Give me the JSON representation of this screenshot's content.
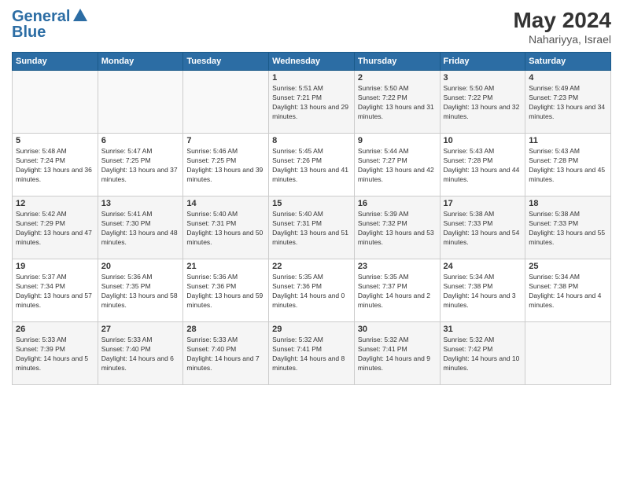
{
  "header": {
    "logo_line1": "General",
    "logo_line2": "Blue",
    "month_year": "May 2024",
    "location": "Nahariyya, Israel"
  },
  "weekdays": [
    "Sunday",
    "Monday",
    "Tuesday",
    "Wednesday",
    "Thursday",
    "Friday",
    "Saturday"
  ],
  "weeks": [
    [
      {
        "day": "",
        "sunrise": "",
        "sunset": "",
        "daylight": ""
      },
      {
        "day": "",
        "sunrise": "",
        "sunset": "",
        "daylight": ""
      },
      {
        "day": "",
        "sunrise": "",
        "sunset": "",
        "daylight": ""
      },
      {
        "day": "1",
        "sunrise": "Sunrise: 5:51 AM",
        "sunset": "Sunset: 7:21 PM",
        "daylight": "Daylight: 13 hours and 29 minutes."
      },
      {
        "day": "2",
        "sunrise": "Sunrise: 5:50 AM",
        "sunset": "Sunset: 7:22 PM",
        "daylight": "Daylight: 13 hours and 31 minutes."
      },
      {
        "day": "3",
        "sunrise": "Sunrise: 5:50 AM",
        "sunset": "Sunset: 7:22 PM",
        "daylight": "Daylight: 13 hours and 32 minutes."
      },
      {
        "day": "4",
        "sunrise": "Sunrise: 5:49 AM",
        "sunset": "Sunset: 7:23 PM",
        "daylight": "Daylight: 13 hours and 34 minutes."
      }
    ],
    [
      {
        "day": "5",
        "sunrise": "Sunrise: 5:48 AM",
        "sunset": "Sunset: 7:24 PM",
        "daylight": "Daylight: 13 hours and 36 minutes."
      },
      {
        "day": "6",
        "sunrise": "Sunrise: 5:47 AM",
        "sunset": "Sunset: 7:25 PM",
        "daylight": "Daylight: 13 hours and 37 minutes."
      },
      {
        "day": "7",
        "sunrise": "Sunrise: 5:46 AM",
        "sunset": "Sunset: 7:25 PM",
        "daylight": "Daylight: 13 hours and 39 minutes."
      },
      {
        "day": "8",
        "sunrise": "Sunrise: 5:45 AM",
        "sunset": "Sunset: 7:26 PM",
        "daylight": "Daylight: 13 hours and 41 minutes."
      },
      {
        "day": "9",
        "sunrise": "Sunrise: 5:44 AM",
        "sunset": "Sunset: 7:27 PM",
        "daylight": "Daylight: 13 hours and 42 minutes."
      },
      {
        "day": "10",
        "sunrise": "Sunrise: 5:43 AM",
        "sunset": "Sunset: 7:28 PM",
        "daylight": "Daylight: 13 hours and 44 minutes."
      },
      {
        "day": "11",
        "sunrise": "Sunrise: 5:43 AM",
        "sunset": "Sunset: 7:28 PM",
        "daylight": "Daylight: 13 hours and 45 minutes."
      }
    ],
    [
      {
        "day": "12",
        "sunrise": "Sunrise: 5:42 AM",
        "sunset": "Sunset: 7:29 PM",
        "daylight": "Daylight: 13 hours and 47 minutes."
      },
      {
        "day": "13",
        "sunrise": "Sunrise: 5:41 AM",
        "sunset": "Sunset: 7:30 PM",
        "daylight": "Daylight: 13 hours and 48 minutes."
      },
      {
        "day": "14",
        "sunrise": "Sunrise: 5:40 AM",
        "sunset": "Sunset: 7:31 PM",
        "daylight": "Daylight: 13 hours and 50 minutes."
      },
      {
        "day": "15",
        "sunrise": "Sunrise: 5:40 AM",
        "sunset": "Sunset: 7:31 PM",
        "daylight": "Daylight: 13 hours and 51 minutes."
      },
      {
        "day": "16",
        "sunrise": "Sunrise: 5:39 AM",
        "sunset": "Sunset: 7:32 PM",
        "daylight": "Daylight: 13 hours and 53 minutes."
      },
      {
        "day": "17",
        "sunrise": "Sunrise: 5:38 AM",
        "sunset": "Sunset: 7:33 PM",
        "daylight": "Daylight: 13 hours and 54 minutes."
      },
      {
        "day": "18",
        "sunrise": "Sunrise: 5:38 AM",
        "sunset": "Sunset: 7:33 PM",
        "daylight": "Daylight: 13 hours and 55 minutes."
      }
    ],
    [
      {
        "day": "19",
        "sunrise": "Sunrise: 5:37 AM",
        "sunset": "Sunset: 7:34 PM",
        "daylight": "Daylight: 13 hours and 57 minutes."
      },
      {
        "day": "20",
        "sunrise": "Sunrise: 5:36 AM",
        "sunset": "Sunset: 7:35 PM",
        "daylight": "Daylight: 13 hours and 58 minutes."
      },
      {
        "day": "21",
        "sunrise": "Sunrise: 5:36 AM",
        "sunset": "Sunset: 7:36 PM",
        "daylight": "Daylight: 13 hours and 59 minutes."
      },
      {
        "day": "22",
        "sunrise": "Sunrise: 5:35 AM",
        "sunset": "Sunset: 7:36 PM",
        "daylight": "Daylight: 14 hours and 0 minutes."
      },
      {
        "day": "23",
        "sunrise": "Sunrise: 5:35 AM",
        "sunset": "Sunset: 7:37 PM",
        "daylight": "Daylight: 14 hours and 2 minutes."
      },
      {
        "day": "24",
        "sunrise": "Sunrise: 5:34 AM",
        "sunset": "Sunset: 7:38 PM",
        "daylight": "Daylight: 14 hours and 3 minutes."
      },
      {
        "day": "25",
        "sunrise": "Sunrise: 5:34 AM",
        "sunset": "Sunset: 7:38 PM",
        "daylight": "Daylight: 14 hours and 4 minutes."
      }
    ],
    [
      {
        "day": "26",
        "sunrise": "Sunrise: 5:33 AM",
        "sunset": "Sunset: 7:39 PM",
        "daylight": "Daylight: 14 hours and 5 minutes."
      },
      {
        "day": "27",
        "sunrise": "Sunrise: 5:33 AM",
        "sunset": "Sunset: 7:40 PM",
        "daylight": "Daylight: 14 hours and 6 minutes."
      },
      {
        "day": "28",
        "sunrise": "Sunrise: 5:33 AM",
        "sunset": "Sunset: 7:40 PM",
        "daylight": "Daylight: 14 hours and 7 minutes."
      },
      {
        "day": "29",
        "sunrise": "Sunrise: 5:32 AM",
        "sunset": "Sunset: 7:41 PM",
        "daylight": "Daylight: 14 hours and 8 minutes."
      },
      {
        "day": "30",
        "sunrise": "Sunrise: 5:32 AM",
        "sunset": "Sunset: 7:41 PM",
        "daylight": "Daylight: 14 hours and 9 minutes."
      },
      {
        "day": "31",
        "sunrise": "Sunrise: 5:32 AM",
        "sunset": "Sunset: 7:42 PM",
        "daylight": "Daylight: 14 hours and 10 minutes."
      },
      {
        "day": "",
        "sunrise": "",
        "sunset": "",
        "daylight": ""
      }
    ]
  ]
}
